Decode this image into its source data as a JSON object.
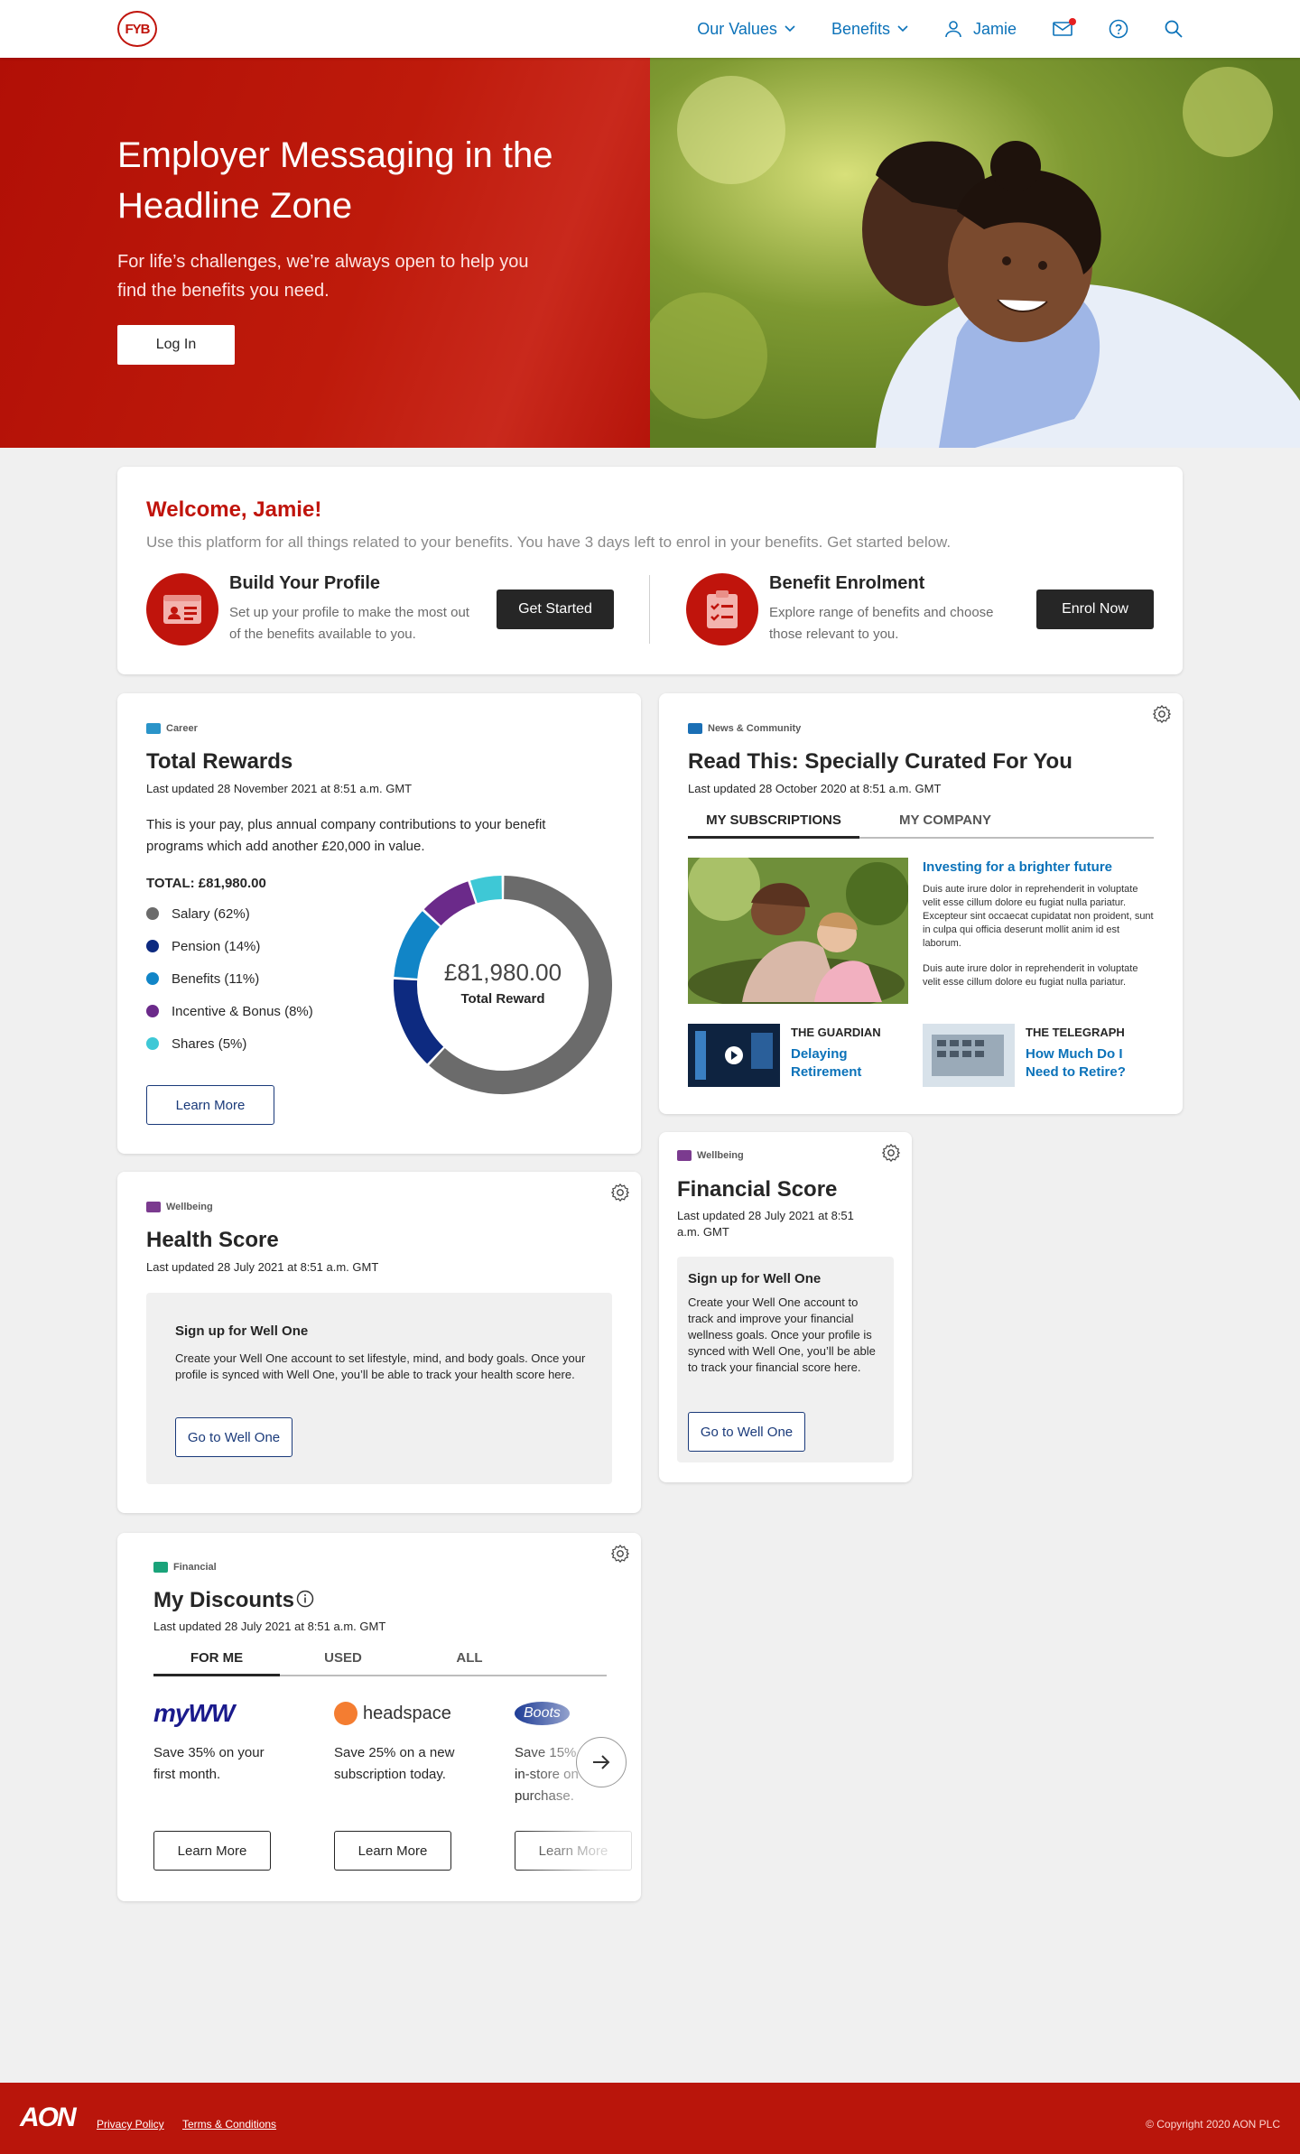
{
  "header": {
    "logo_text": "FYB",
    "nav": {
      "our_values": "Our Values",
      "benefits": "Benefits",
      "user": "Jamie"
    }
  },
  "hero": {
    "title": "Employer Messaging in the Headline Zone",
    "subtitle": "For life’s challenges, we’re always open to help you find the benefits you need.",
    "login_label": "Log In"
  },
  "welcome": {
    "title": "Welcome, Jamie!",
    "subtitle": "Use this platform for all things related to your benefits. You have 3 days left to enrol in your benefits. Get started below.",
    "profile": {
      "heading": "Build Your Profile",
      "text": "Set up your profile to make the most out of the benefits available to you.",
      "button": "Get Started"
    },
    "enrolment": {
      "heading": "Benefit Enrolment",
      "text": "Explore range of benefits and choose those relevant to you.",
      "button": "Enrol Now"
    }
  },
  "rewards": {
    "tag": "Career",
    "title": "Total Rewards",
    "updated": "Last updated 28 November 2021 at 8:51 a.m. GMT",
    "description": "This is your pay, plus annual company contributions to your benefit programs which add another £20,000 in value.",
    "total_label": "TOTAL: £81,980.00",
    "center_value": "£81,980.00",
    "center_label": "Total Reward",
    "learn_more": "Learn More",
    "colors": {
      "salary": "#6b6b6b",
      "pension": "#0d2a80",
      "benefits": "#1185c7",
      "incentive": "#6b2a8a",
      "shares": "#3ec8d6"
    }
  },
  "chart_data": {
    "type": "pie",
    "categories": [
      "Salary",
      "Pension",
      "Benefits",
      "Incentive & Bonus",
      "Shares"
    ],
    "values": [
      62,
      14,
      11,
      8,
      5
    ],
    "labels": [
      "Salary (62%)",
      "Pension (14%)",
      "Benefits (11%)",
      "Incentive & Bonus (8%)",
      "Shares (5%)"
    ],
    "colors": [
      "#6b6b6b",
      "#0d2a80",
      "#1185c7",
      "#6b2a8a",
      "#3ec8d6"
    ],
    "title": "",
    "legend": "left"
  },
  "news": {
    "tag": "News & Community",
    "title": "Read This: Specially Curated For You",
    "updated": "Last updated 28 October 2020 at 8:51 a.m. GMT",
    "tabs": [
      "MY SUBSCRIPTIONS",
      "MY COMPANY"
    ],
    "feature": {
      "headline": "Investing for a brighter future",
      "para1": "Duis aute irure dolor in reprehenderit in voluptate velit esse cillum dolore eu fugiat nulla pariatur. Excepteur sint occaecat cupidatat non proident, sunt in culpa qui officia deserunt mollit anim id est laborum.",
      "para2": "Duis aute irure dolor in reprehenderit in voluptate velit esse cillum dolore eu fugiat nulla pariatur."
    },
    "items": [
      {
        "source": "THE GUARDIAN",
        "headline": "Delaying Retirement"
      },
      {
        "source": "THE TELEGRAPH",
        "headline": "How Much Do I Need to Retire?"
      }
    ]
  },
  "health": {
    "tag": "Wellbeing",
    "title": "Health Score",
    "updated": "Last updated 28 July 2021 at 8:51 a.m. GMT",
    "box_title": "Sign up for Well One",
    "box_text": "Create your Well One account to set lifestyle, mind, and body goals. Once your profile is synced with Well One, you’ll be able to track your health score here.",
    "button": "Go to Well One"
  },
  "financial": {
    "tag": "Wellbeing",
    "title": "Financial Score",
    "updated": "Last updated 28 July 2021 at 8:51 a.m. GMT",
    "box_title": "Sign up for Well One",
    "box_text": "Create your Well One account to track and improve your financial wellness goals. Once your profile is synced with Well One, you’ll be able to track your financial score here.",
    "button": "Go to Well One"
  },
  "discounts": {
    "tag": "Financial",
    "title": "My Discounts",
    "updated": "Last updated 28 July 2021 at 8:51 a.m. GMT",
    "tabs": [
      "FOR ME",
      "USED",
      "ALL"
    ],
    "offers": [
      {
        "brand": "myWW",
        "text": "Save 35% on your first month.",
        "button": "Learn More"
      },
      {
        "brand": "headspace",
        "text": "Save 25% on a new subscription today.",
        "button": "Learn More"
      },
      {
        "brand": "Boots",
        "text": "Save 15% in-store on purchase.",
        "button": "Learn More"
      }
    ]
  },
  "footer": {
    "logo": "AON",
    "privacy": "Privacy Policy",
    "terms": "Terms & Conditions",
    "copyright": "© Copyright 2020 AON PLC"
  }
}
